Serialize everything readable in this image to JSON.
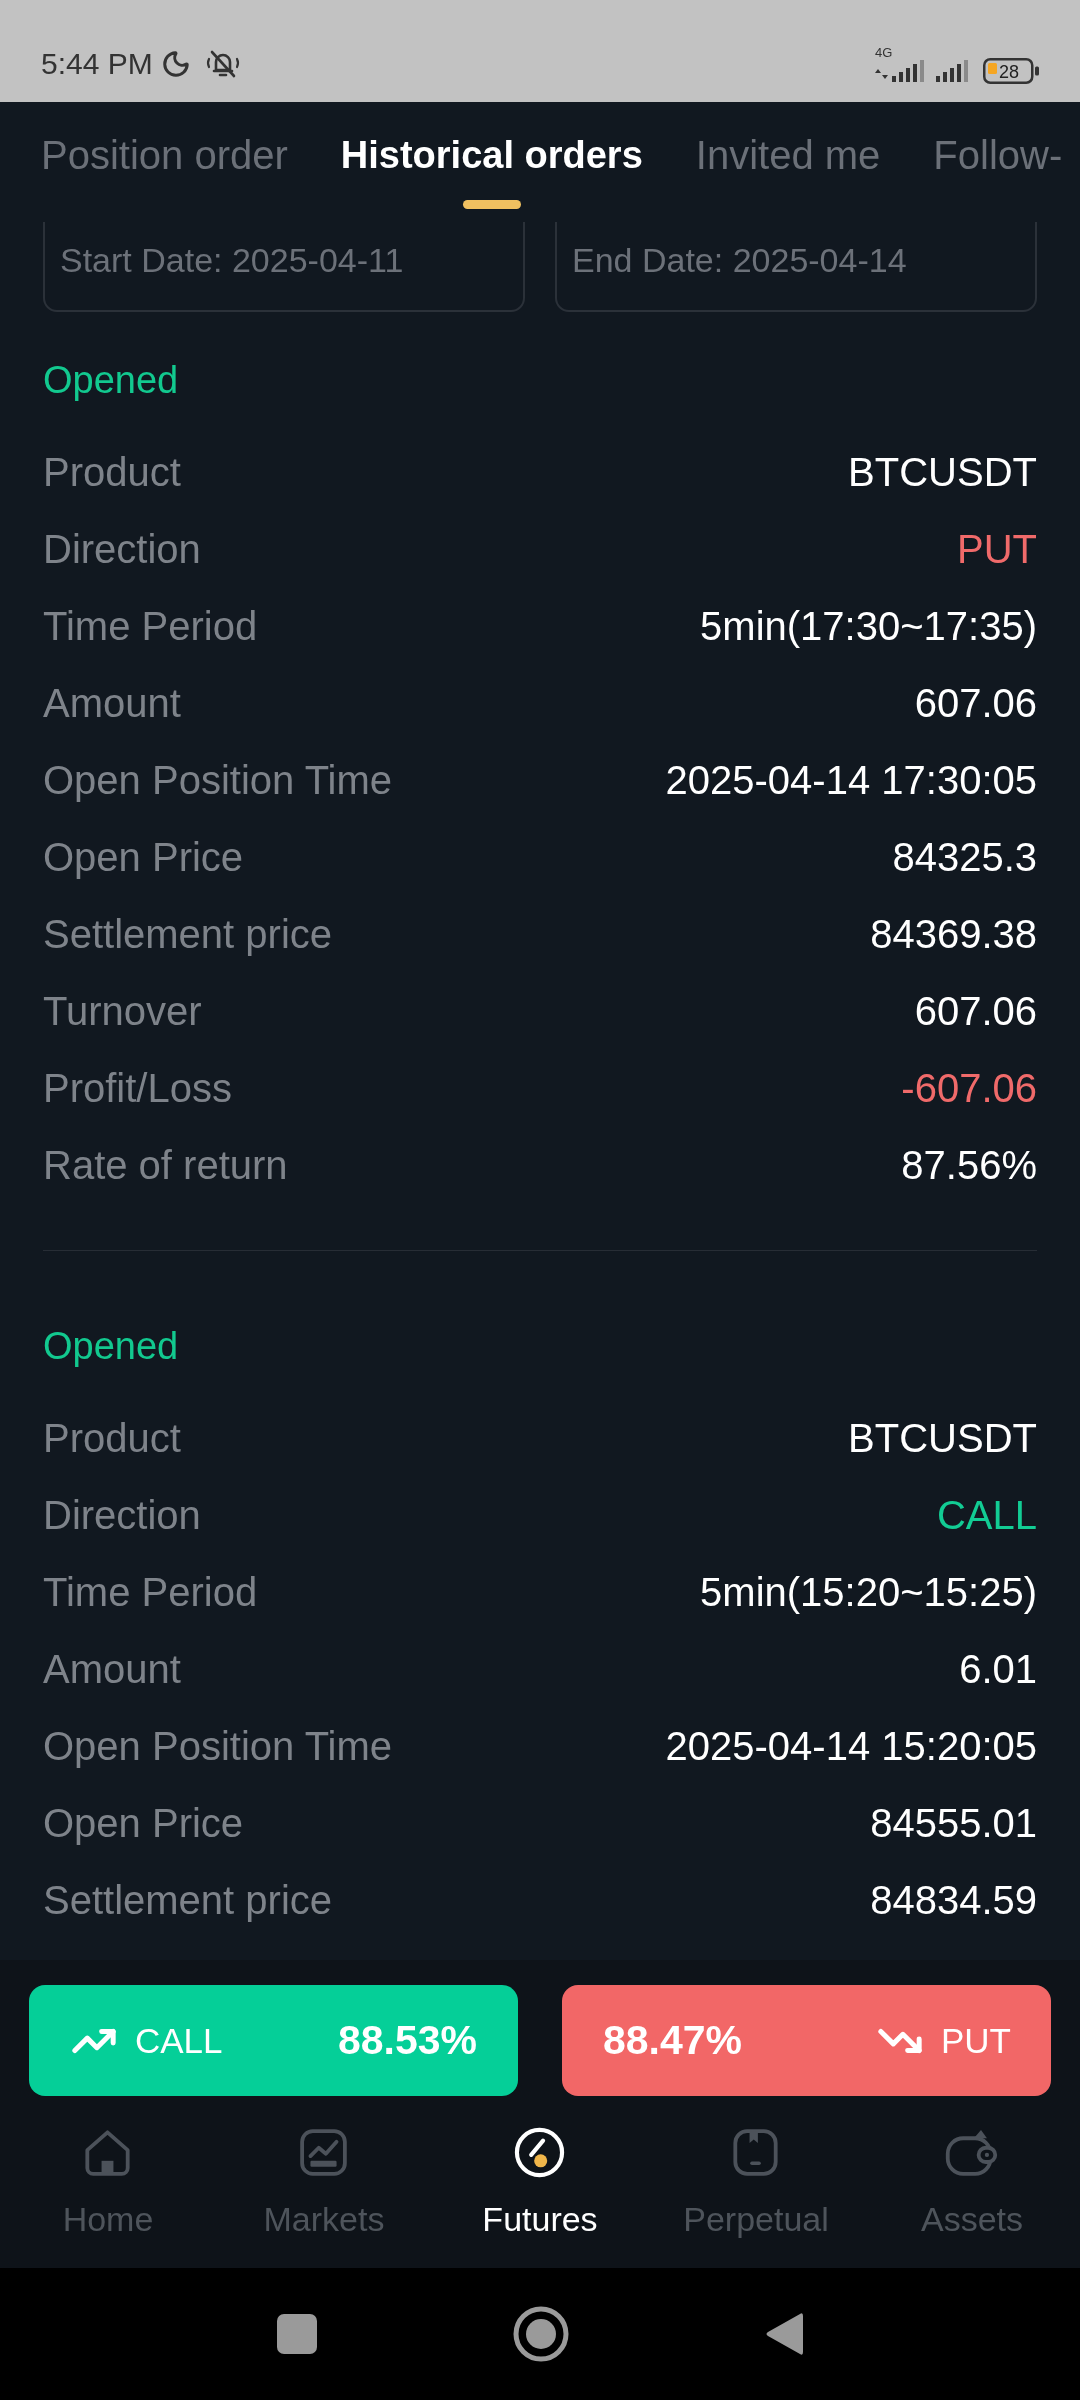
{
  "status_bar": {
    "time": "5:44 PM",
    "network": "4G",
    "battery": "28"
  },
  "tabs": [
    {
      "label": "Position order",
      "selected": false
    },
    {
      "label": "Historical orders",
      "selected": true
    },
    {
      "label": "Invited me",
      "selected": false
    },
    {
      "label": "Follow-",
      "selected": false
    }
  ],
  "date_filter": {
    "start_date": {
      "value": "Start Date: 2025-04-11"
    },
    "end_date": {
      "value": "End Date: 2025-04-14"
    }
  },
  "orders": [
    {
      "status": "Opened",
      "fields": [
        {
          "label": "Product",
          "value": "BTCUSDT",
          "color": "#ffffff"
        },
        {
          "label": "Direction",
          "value": "PUT",
          "color": "#f06a6a"
        },
        {
          "label": "Time Period",
          "value": "5min(17:30~17:35)",
          "color": "#ffffff"
        },
        {
          "label": "Amount",
          "value": "607.06",
          "color": "#ffffff"
        },
        {
          "label": "Open Position Time",
          "value": "2025-04-14 17:30:05",
          "color": "#ffffff"
        },
        {
          "label": "Open Price",
          "value": "84325.3",
          "color": "#ffffff"
        },
        {
          "label": "Settlement price",
          "value": "84369.38",
          "color": "#ffffff"
        },
        {
          "label": "Turnover",
          "value": "607.06",
          "color": "#ffffff"
        },
        {
          "label": "Profit/Loss",
          "value": "-607.06",
          "color": "#f06a6a"
        },
        {
          "label": "Rate of return",
          "value": "87.56%",
          "color": "#ffffff"
        }
      ]
    },
    {
      "status": "Opened",
      "fields": [
        {
          "label": "Product",
          "value": "BTCUSDT",
          "color": "#ffffff"
        },
        {
          "label": "Direction",
          "value": "CALL",
          "color": "#12cc94"
        },
        {
          "label": "Time Period",
          "value": "5min(15:20~15:25)",
          "color": "#ffffff"
        },
        {
          "label": "Amount",
          "value": "6.01",
          "color": "#ffffff"
        },
        {
          "label": "Open Position Time",
          "value": "2025-04-14 15:20:05",
          "color": "#ffffff"
        },
        {
          "label": "Open Price",
          "value": "84555.01",
          "color": "#ffffff"
        },
        {
          "label": "Settlement price",
          "value": "84834.59",
          "color": "#ffffff"
        }
      ]
    }
  ],
  "trade_buttons": [
    {
      "kind": "call",
      "label": "CALL",
      "rate": "88.53%"
    },
    {
      "kind": "put",
      "label": "PUT",
      "rate": "88.47%"
    }
  ],
  "bottom_nav": [
    {
      "label": "Home",
      "selected": false
    },
    {
      "label": "Markets",
      "selected": false
    },
    {
      "label": "Futures",
      "selected": true
    },
    {
      "label": "Perpetual",
      "selected": false
    },
    {
      "label": "Assets",
      "selected": false
    }
  ]
}
